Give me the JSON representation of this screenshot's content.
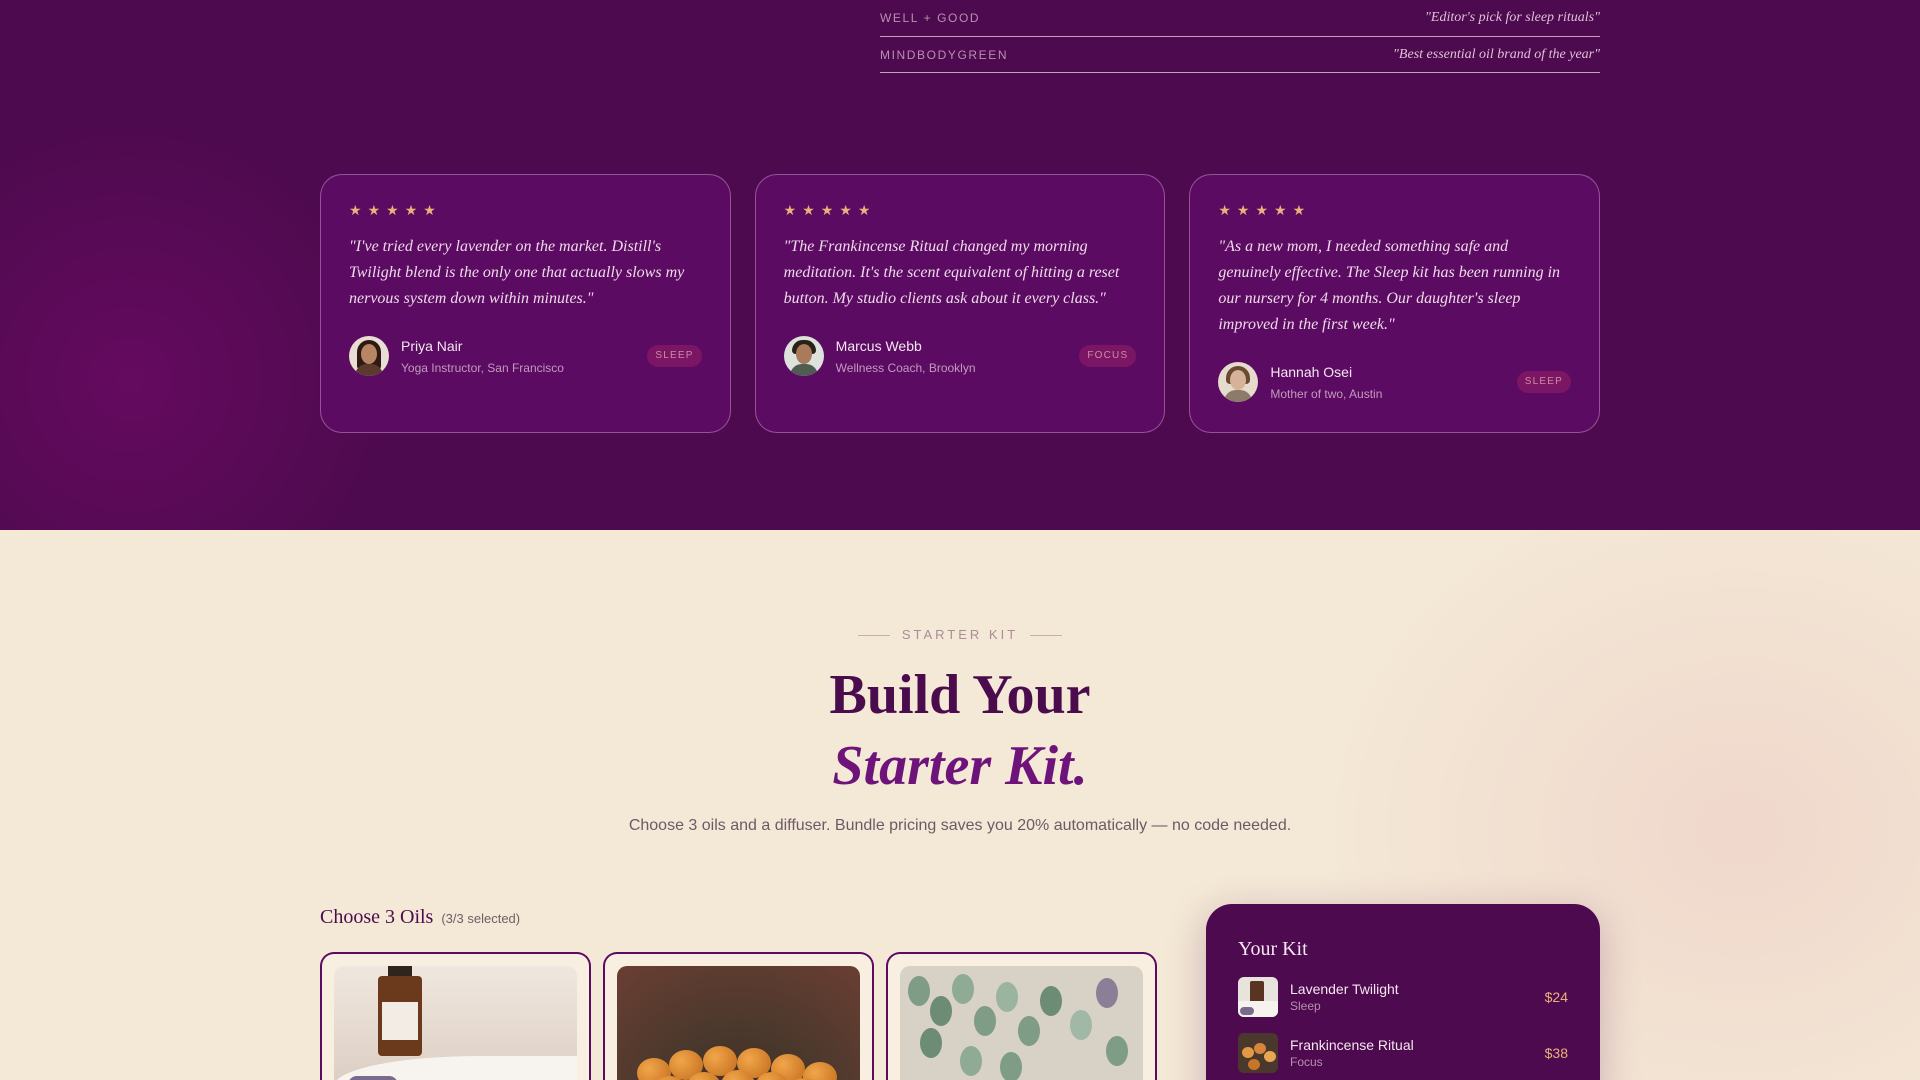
{
  "press": [
    {
      "source": "WELL + GOOD",
      "quote": "\"Editor's pick for sleep rituals\""
    },
    {
      "source": "MINDBODYGREEN",
      "quote": "\"Best essential oil brand of the year\""
    }
  ],
  "reviews": [
    {
      "stars": "★★★★★",
      "rating": 5,
      "text": "\"I've tried every lavender on the market. Distill's Twilight blend is the only one that actually slows my nervous system down within minutes.\"",
      "name": "Priya Nair",
      "role": "Yoga Instructor, San Francisco",
      "tag": "SLEEP"
    },
    {
      "stars": "★★★★★",
      "rating": 5,
      "text": "\"The Frankincense Ritual changed my morning meditation. It's the scent equivalent of hitting a reset button. My studio clients ask about it every class.\"",
      "name": "Marcus Webb",
      "role": "Wellness Coach, Brooklyn",
      "tag": "FOCUS"
    },
    {
      "stars": "★★★★★",
      "rating": 5,
      "text": "\"As a new mom, I needed something safe and genuinely effective. The Sleep kit has been running in our nursery for 4 months. Our daughter's sleep improved in the first week.\"",
      "name": "Hannah Osei",
      "role": "Mother of two, Austin",
      "tag": "SLEEP"
    }
  ],
  "starter_kit": {
    "eyebrow": "STARTER KIT",
    "heading_line1": "Build Your",
    "heading_line2": "Starter Kit.",
    "lede": "Choose 3 oils and a diffuser. Bundle pricing saves you 20% automatically — no code needed.",
    "choose_title": "Choose 3 Oils",
    "choose_count": "(3/3 selected)"
  },
  "kit": {
    "title": "Your Kit",
    "items": [
      {
        "name": "Lavender Twilight",
        "category": "Sleep",
        "price": "$24"
      },
      {
        "name": "Frankincense Ritual",
        "category": "Focus",
        "price": "$38"
      }
    ]
  },
  "colors": {
    "purple_dark": "#4e0a4e",
    "card_purple": "#5c0b62",
    "star_gold": "#e9b27a",
    "cream": "#f4e8d6",
    "accent_purple": "#6d137a"
  }
}
